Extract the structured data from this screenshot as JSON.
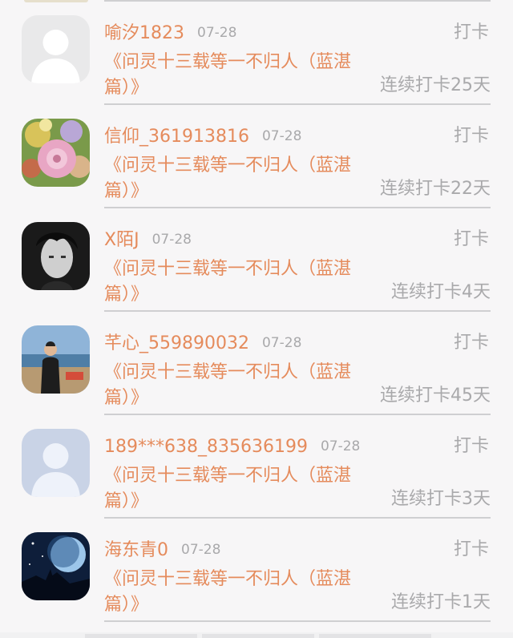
{
  "colors": {
    "accent": "#e58b5c",
    "muted": "#a9a9ab",
    "divider": "#cfcfd1",
    "background": "#f7f6f7"
  },
  "list": {
    "items": [
      {
        "name": "喻汐1823",
        "date": "07-28",
        "action": "打卡",
        "title": "《问灵十三载等一不归人（蓝湛篇）》",
        "streak": "连续打卡25天",
        "avatar": "default-gray-avatar"
      },
      {
        "name": "信仰_361913816",
        "date": "07-28",
        "action": "打卡",
        "title": "《问灵十三载等一不归人（蓝湛篇）》",
        "streak": "连续打卡22天",
        "avatar": "flower-bouquet-avatar"
      },
      {
        "name": "X陌J",
        "date": "07-28",
        "action": "打卡",
        "title": "《问灵十三载等一不归人（蓝湛篇）》",
        "streak": "连续打卡4天",
        "avatar": "bw-portrait-avatar"
      },
      {
        "name": "芊心_559890032",
        "date": "07-28",
        "action": "打卡",
        "title": "《问灵十三载等一不归人（蓝湛篇）》",
        "streak": "连续打卡45天",
        "avatar": "outdoor-person-avatar"
      },
      {
        "name": "189***638_835636199",
        "date": "07-28",
        "action": "打卡",
        "title": "《问灵十三载等一不归人（蓝湛篇）》",
        "streak": "连续打卡3天",
        "avatar": "default-blue-avatar"
      },
      {
        "name": "海东青0",
        "date": "07-28",
        "action": "打卡",
        "title": "《问灵十三载等一不归人（蓝湛篇）》",
        "streak": "连续打卡1天",
        "avatar": "night-moon-avatar"
      }
    ]
  }
}
